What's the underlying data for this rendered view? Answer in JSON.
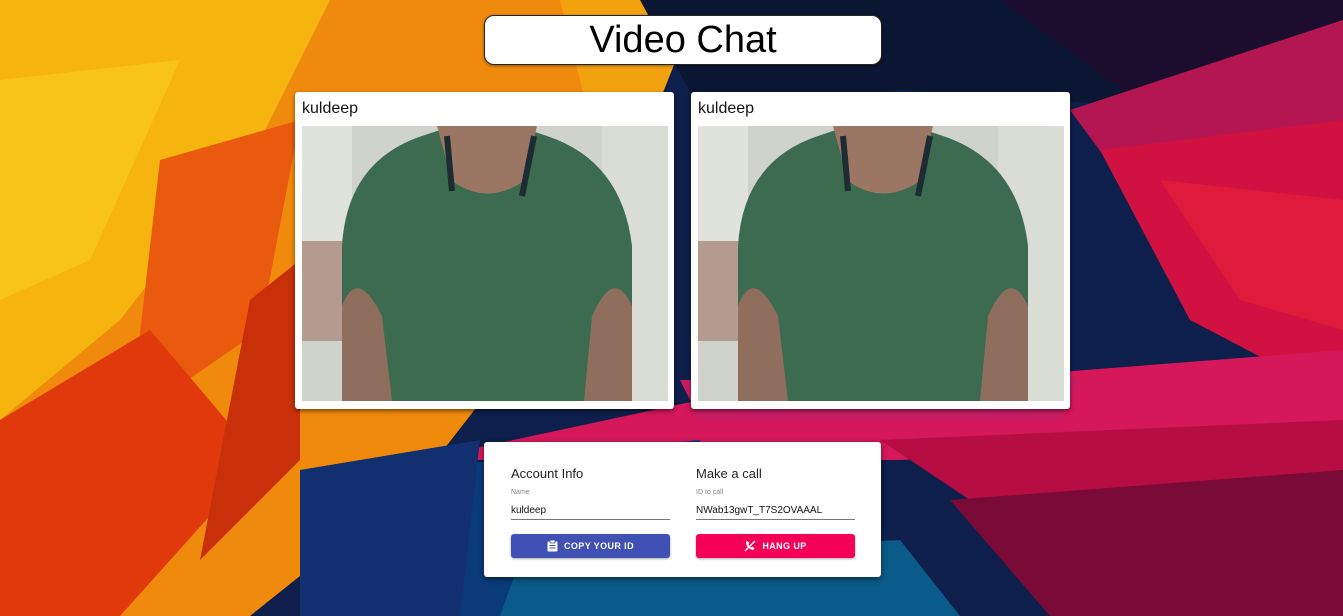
{
  "header": {
    "title": "Video Chat"
  },
  "videos": [
    {
      "name": "kuldeep"
    },
    {
      "name": "kuldeep"
    }
  ],
  "account": {
    "heading": "Account Info",
    "name_label": "Name",
    "name_value": "kuldeep",
    "copy_button": "COPY YOUR ID",
    "copy_icon": "clipboard-icon"
  },
  "call": {
    "heading": "Make a call",
    "id_label": "ID to call",
    "id_value": "NWab13gwT_T7S2OVAAAL",
    "hangup_button": "HANG UP",
    "hangup_icon": "phone-disabled-icon"
  },
  "colors": {
    "primary": "#3f51b5",
    "secondary": "#f50057"
  }
}
